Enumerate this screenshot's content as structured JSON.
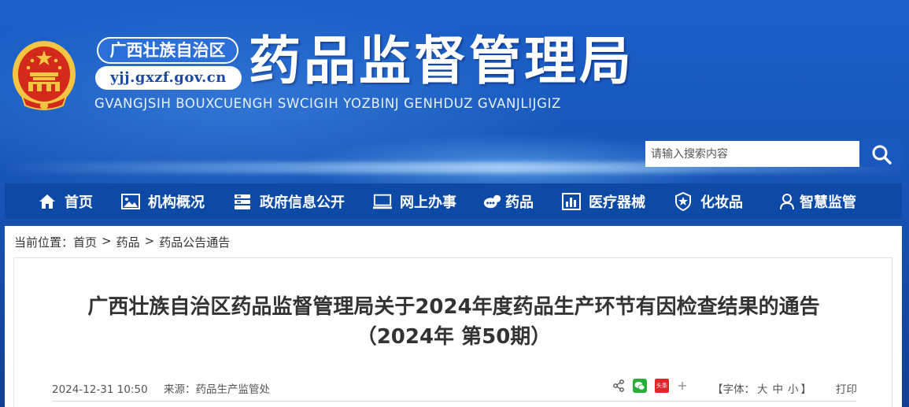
{
  "header": {
    "region_label": "广西壮族自治区",
    "domain": "yjj.gxzf.gov.cn",
    "title": "药品监督管理局",
    "subtitle": "GVANGJSIH BOUXCUENGH SWCIGIH YOZBINJ GENHDUZ GVANJLIJGIZ"
  },
  "search": {
    "placeholder": "请输入搜索内容",
    "value": ""
  },
  "nav": {
    "items": [
      {
        "label": "首页",
        "icon": "home-icon"
      },
      {
        "label": "机构概况",
        "icon": "image-icon"
      },
      {
        "label": "政府信息公开",
        "icon": "stack-icon"
      },
      {
        "label": "网上办事",
        "icon": "monitor-icon"
      },
      {
        "label": "药品",
        "icon": "pill-icon"
      },
      {
        "label": "医疗器械",
        "icon": "bar-chart-icon"
      },
      {
        "label": "化妆品",
        "icon": "shield-star-icon"
      },
      {
        "label": "智慧监管",
        "icon": "user-icon"
      }
    ]
  },
  "breadcrumb": {
    "prefix": "当前位置：",
    "items": [
      "首页",
      "药品",
      "药品公告通告"
    ],
    "separator": ">"
  },
  "article": {
    "title_line1": "广西壮族自治区药品监督管理局关于2024年度药品生产环节有因检查结果的通告",
    "title_line2": "（2024年 第50期）",
    "date": "2024-12-31 10:50",
    "source": "来源：药品生产监管处",
    "font_label_open": "【字体：",
    "font_large": "大",
    "font_medium": "中",
    "font_small": "小",
    "font_label_close": "】",
    "print": "打印",
    "share_icons": [
      "share-icon",
      "wechat-icon",
      "weibo-icon",
      "plus-icon"
    ],
    "weibo_text": "头条"
  },
  "colors": {
    "banner_blue": "#1b5fc9",
    "nav_blue": "#0d4aa6",
    "emblem_red": "#d42a1c",
    "emblem_gold": "#f4c542"
  }
}
